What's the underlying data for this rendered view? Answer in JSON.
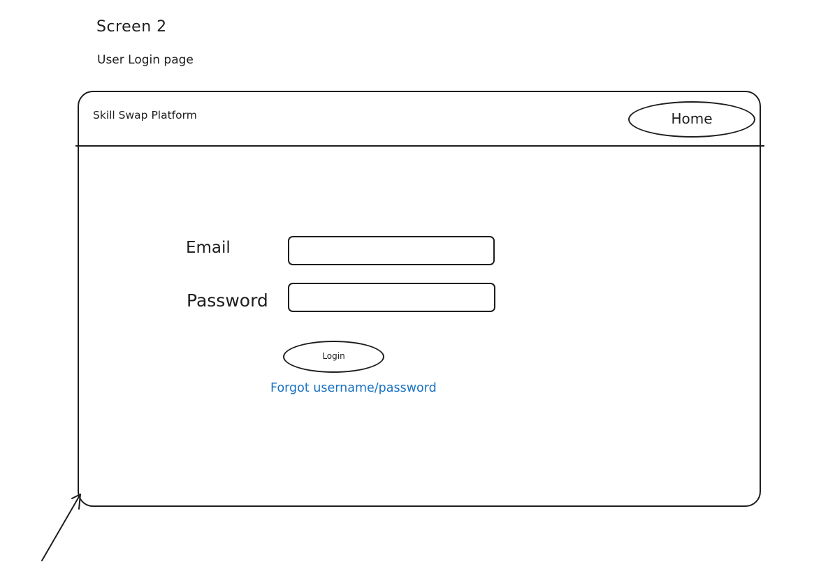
{
  "screen": {
    "title": "Screen 2",
    "subtitle": "User Login page"
  },
  "header": {
    "brand": "Skill Swap Platform",
    "home_label": "Home"
  },
  "form": {
    "email_label": "Email",
    "email_value": "",
    "password_label": "Password",
    "password_value": "",
    "login_label": "Login",
    "forgot_label": "Forgot username/password"
  },
  "colors": {
    "ink": "#1e1e1e",
    "link": "#1971c2",
    "background": "#ffffff"
  },
  "icons": {
    "annotation_arrow": "arrow-up-right-icon"
  }
}
